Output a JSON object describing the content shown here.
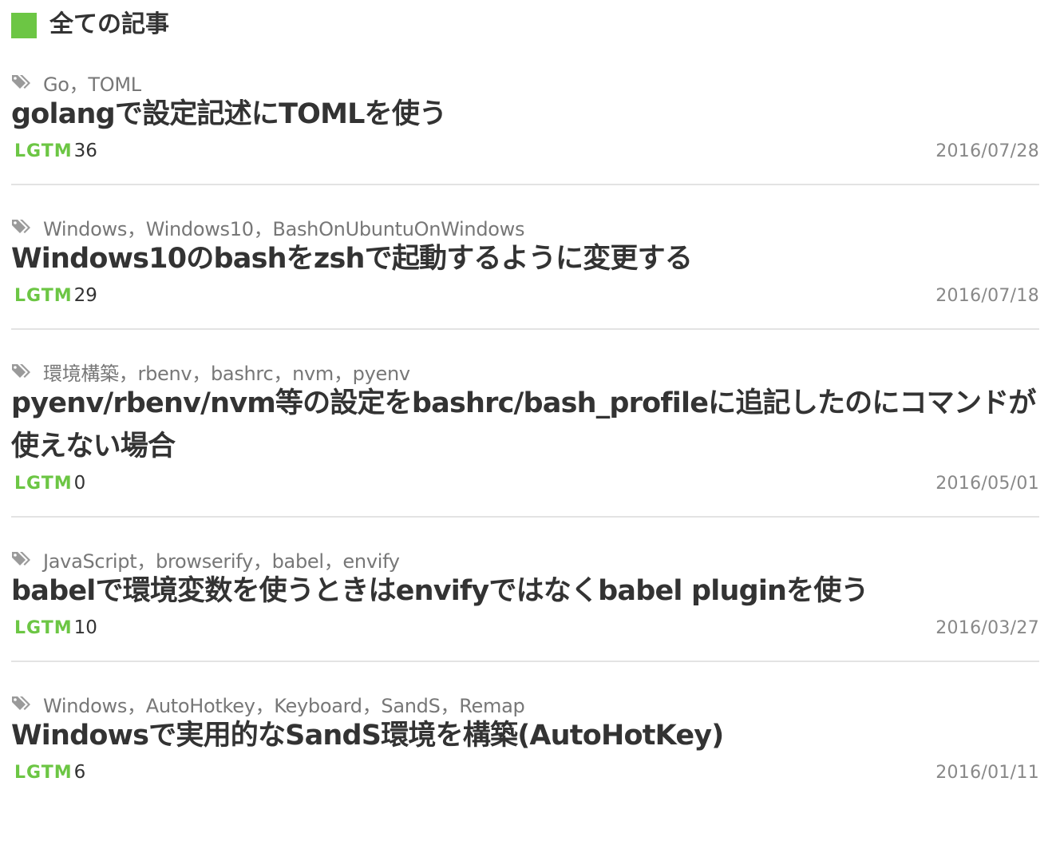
{
  "section": {
    "title": "全ての記事"
  },
  "articles": [
    {
      "tags": "Go，TOML",
      "title": "golangで設定記述にTOMLを使う",
      "lgtm_label": "LGTM",
      "lgtm_count": "36",
      "date": "2016/07/28"
    },
    {
      "tags": "Windows，Windows10，BashOnUbuntuOnWindows",
      "title": "Windows10のbashをzshで起動するように変更する",
      "lgtm_label": "LGTM",
      "lgtm_count": "29",
      "date": "2016/07/18"
    },
    {
      "tags": "環境構築，rbenv，bashrc，nvm，pyenv",
      "title": "pyenv/rbenv/nvm等の設定をbashrc/bash_profileに追記したのにコマンドが使えない場合",
      "lgtm_label": "LGTM",
      "lgtm_count": "0",
      "date": "2016/05/01"
    },
    {
      "tags": "JavaScript，browserify，babel，envify",
      "title": "babelで環境変数を使うときはenvifyではなくbabel pluginを使う",
      "lgtm_label": "LGTM",
      "lgtm_count": "10",
      "date": "2016/03/27"
    },
    {
      "tags": "Windows，AutoHotkey，Keyboard，SandS，Remap",
      "title": "Windowsで実用的なSandS環境を構築(AutoHotKey)",
      "lgtm_label": "LGTM",
      "lgtm_count": "6",
      "date": "2016/01/11"
    }
  ],
  "colors": {
    "accent": "#6cc644",
    "text": "#333333",
    "muted": "#777777",
    "divider": "#e3e3e3"
  },
  "icons": {
    "tag": "tags-icon"
  }
}
